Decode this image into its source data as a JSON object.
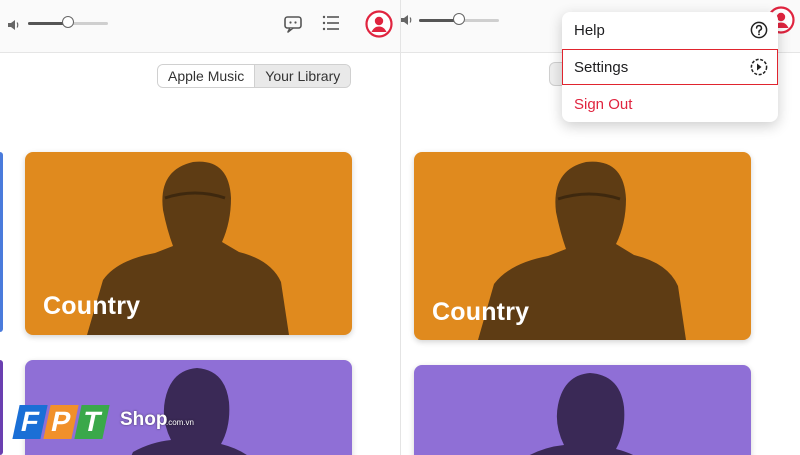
{
  "left_pane": {
    "volume": {
      "level": 0.6
    },
    "segment": {
      "apple_music": "Apple Music",
      "your_library": "Your Library",
      "selected": "Apple Music"
    },
    "cards": [
      {
        "title": "Country",
        "color": "#e08a1e"
      },
      {
        "title": "",
        "color": "#8f6fd6"
      }
    ]
  },
  "right_pane": {
    "volume": {
      "level": 0.45
    },
    "cards": [
      {
        "title": "Country",
        "color": "#e08a1e"
      },
      {
        "title": "",
        "color": "#8f6fd6"
      }
    ]
  },
  "account_menu": {
    "items": [
      {
        "label": "Help",
        "icon": "help-circle-icon"
      },
      {
        "label": "Settings",
        "icon": "settings-arrow-icon",
        "highlighted": true
      },
      {
        "label": "Sign Out",
        "icon": "",
        "color": "#e0243f"
      }
    ]
  },
  "icons": {
    "volume": "speaker-icon",
    "lyrics": "lyrics-bubble-icon",
    "queue": "queue-list-icon",
    "account": "account-avatar-icon"
  },
  "colors": {
    "accent": "#e0243f",
    "country_card": "#e08a1e",
    "purple_card": "#8f6fd6"
  },
  "watermark": {
    "letters": [
      "F",
      "P",
      "T"
    ],
    "brand": "Shop",
    "domain": ".com.vn"
  }
}
